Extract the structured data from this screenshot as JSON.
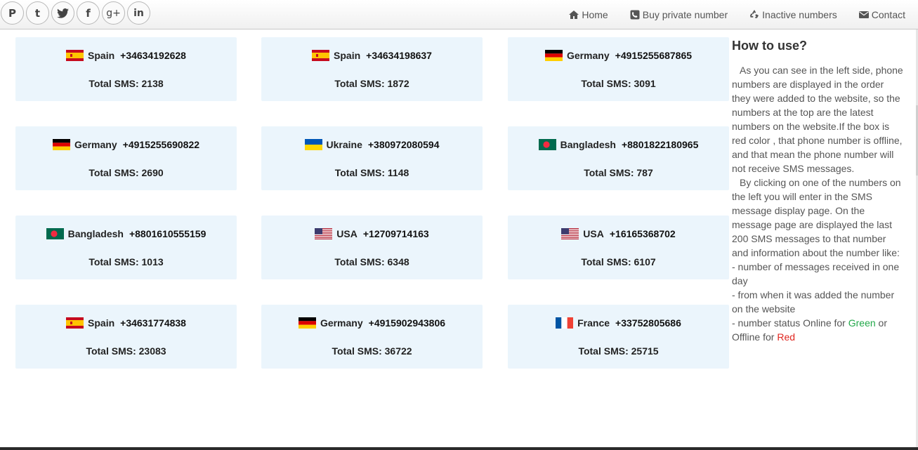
{
  "social": [
    {
      "icon": "pinterest-icon",
      "glyph": "P"
    },
    {
      "icon": "tumblr-icon",
      "glyph": "t"
    },
    {
      "icon": "twitter-icon",
      "glyph": "🐦"
    },
    {
      "icon": "facebook-icon",
      "glyph": "f"
    },
    {
      "icon": "google-plus-icon",
      "glyph": "g+"
    },
    {
      "icon": "linkedin-icon",
      "glyph": "in"
    }
  ],
  "nav": {
    "home": "Home",
    "buy": "Buy private number",
    "inactive": "Inactive numbers",
    "contact": "Contact"
  },
  "cards": [
    {
      "country": "Spain",
      "phone": "+34634192628",
      "total": "Total SMS: 2138"
    },
    {
      "country": "Spain",
      "phone": "+34634198637",
      "total": "Total SMS: 1872"
    },
    {
      "country": "Germany",
      "phone": "+4915255687865",
      "total": "Total SMS: 3091"
    },
    {
      "country": "Germany",
      "phone": "+4915255690822",
      "total": "Total SMS: 2690"
    },
    {
      "country": "Ukraine",
      "phone": "+380972080594",
      "total": "Total SMS: 1148"
    },
    {
      "country": "Bangladesh",
      "phone": "+8801822180965",
      "total": "Total SMS: 787"
    },
    {
      "country": "Bangladesh",
      "phone": "+8801610555159",
      "total": "Total SMS: 1013"
    },
    {
      "country": "USA",
      "phone": "+12709714163",
      "total": "Total SMS: 6348"
    },
    {
      "country": "USA",
      "phone": "+16165368702",
      "total": "Total SMS: 6107"
    },
    {
      "country": "Spain",
      "phone": "+34631774838",
      "total": "Total SMS: 23083"
    },
    {
      "country": "Germany",
      "phone": "+4915902943806",
      "total": "Total SMS: 36722"
    },
    {
      "country": "France",
      "phone": "+33752805686",
      "total": "Total SMS: 25715"
    }
  ],
  "sidebar": {
    "title": "How to use?",
    "para1": "As you can see in the left side, phone numbers are displayed in the order they were added to the website, so the numbers at the top are the latest numbers on the website.If the box is red color , that phone number is offline, and that mean the phone number will not receive SMS messages.",
    "para2": "By clicking on one of the numbers on the left you will enter in the SMS message display page. On the message page are displayed the last 200 SMS messages to that number and information about the number like:",
    "item1": "- number of messages received in one day",
    "item2": "- from when it was added the number on the website",
    "item3_prefix": "- number status Online for ",
    "green_word": "Green",
    "item3_mid": " or Offline for ",
    "red_word": "Red"
  },
  "colors": {
    "card_bg": "#ebf5fc",
    "green": "#21a849",
    "red": "#e0261f"
  }
}
